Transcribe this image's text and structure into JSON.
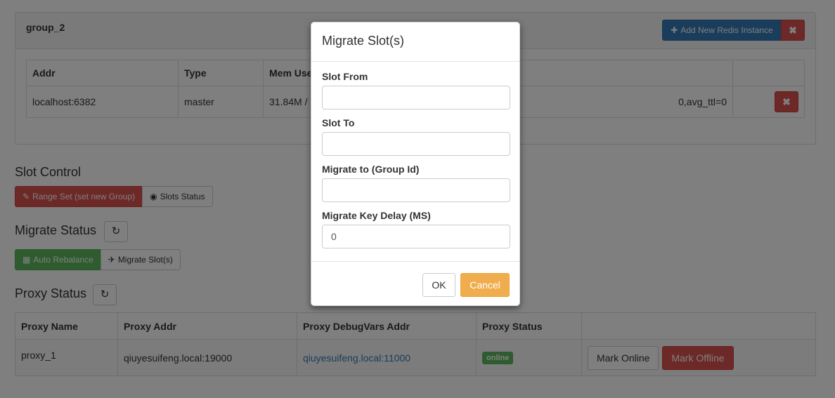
{
  "group": {
    "title": "group_2",
    "add_label": "Add New Redis Instance",
    "remove_label": "✖",
    "columns": [
      "Addr",
      "Type",
      "Mem Used"
    ],
    "row": {
      "addr": "localhost:6382",
      "type": "master",
      "mem": "31.84M /",
      "info": "0,avg_ttl=0",
      "remove_label": "✖"
    }
  },
  "slot_control": {
    "title": "Slot Control",
    "range_set_label": "Range Set (set new Group)",
    "slots_status_label": "Slots Status"
  },
  "migrate_status": {
    "title": "Migrate Status",
    "auto_rebalance_label": "Auto Rebalance",
    "migrate_slots_label": "Migrate Slot(s)"
  },
  "proxy_status": {
    "title": "Proxy Status",
    "columns": [
      "Proxy Name",
      "Proxy Addr",
      "Proxy DebugVars Addr",
      "Proxy Status",
      ""
    ],
    "rows": [
      {
        "name": "proxy_1",
        "addr": "qiuyesuifeng.local:19000",
        "debug_addr": "qiuyesuifeng.local:11000",
        "status": "online",
        "mark_online": "Mark Online",
        "mark_offline": "Mark Offline"
      }
    ]
  },
  "modal": {
    "title": "Migrate Slot(s)",
    "slot_from_label": "Slot From",
    "slot_from_value": "",
    "slot_to_label": "Slot To",
    "slot_to_value": "",
    "group_id_label": "Migrate to (Group Id)",
    "group_id_value": "",
    "delay_label": "Migrate Key Delay (MS)",
    "delay_value": "0",
    "ok_label": "OK",
    "cancel_label": "Cancel"
  },
  "colors": {
    "primary": "#337ab7",
    "danger": "#d9534f",
    "success": "#5cb85c",
    "warning": "#f0ad4e"
  },
  "icons": {
    "add": "plus-icon",
    "remove": "close-icon",
    "range_set": "pencil-icon",
    "slots_status": "eye-icon",
    "refresh": "refresh-icon",
    "auto_rebalance": "grid-icon",
    "migrate": "plane-icon"
  }
}
